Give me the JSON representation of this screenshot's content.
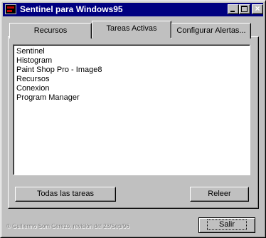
{
  "window": {
    "title": "Sentinel para Windows95",
    "controls": {
      "minimize": "minimize-icon",
      "maximize": "maximize-icon",
      "close": "close-icon"
    }
  },
  "tabs": [
    {
      "label": "Recursos",
      "selected": false
    },
    {
      "label": "Tareas Activas",
      "selected": true
    },
    {
      "label": "Configurar Alertas...",
      "selected": false
    }
  ],
  "tasks": [
    "Sentinel",
    "Histogram",
    "Paint Shop Pro - Image8",
    "Recursos",
    "Conexion",
    "Program Manager"
  ],
  "buttons": {
    "todas": "Todas las tareas",
    "releer": "Releer",
    "salir": "Salir"
  },
  "footer": "® Guillermo Som Cerezo, revisión del 28/Sep/96",
  "colors": {
    "titlebar": "#000080",
    "face": "#c0c0c0"
  }
}
